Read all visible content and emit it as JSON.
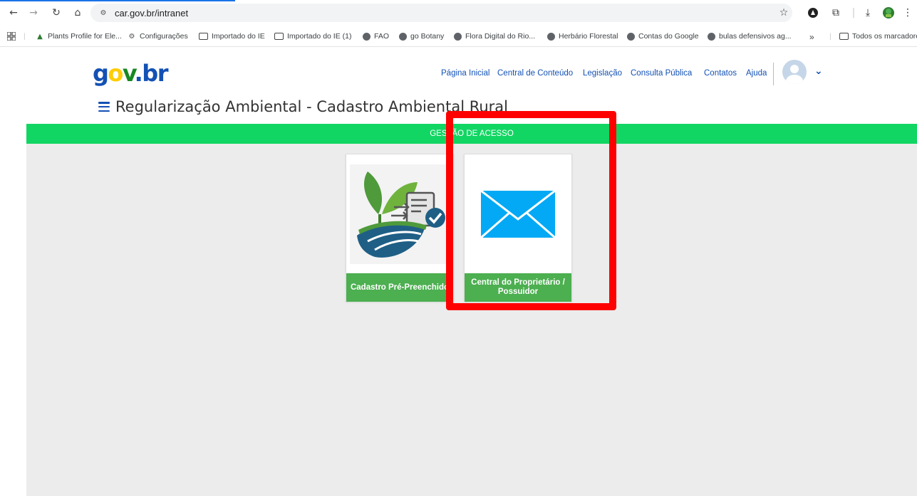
{
  "browser": {
    "url": "car.gov.br/intranet",
    "nav_back": "←",
    "nav_forward": "→",
    "nav_reload": "↻",
    "nav_home": "⌂",
    "star": "☆",
    "ext_puzzle": "⧉",
    "download": "⤓",
    "menu": "⋮",
    "sep": "|",
    "bookmarks": [
      "Plants Profile for Ele...",
      "Configurações",
      "Importado do IE",
      "Importado do IE (1)",
      "FAO",
      "go Botany",
      "Flora Digital do Rio...",
      "Herbário Florestal",
      "Contas do Google",
      "bulas defensivos ag..."
    ],
    "more_bookmarks": "»",
    "all_bookmarks": "Todos os marcadores"
  },
  "header": {
    "logo_g": "g",
    "logo_o": "o",
    "logo_v": "v",
    "logo_dot": ".",
    "logo_br": "br",
    "nav": [
      "Página Inicial",
      "Central de Conteúdo",
      "Legislação",
      "Consulta Pública",
      "Contatos",
      "Ajuda"
    ],
    "chevron": "⌄"
  },
  "page": {
    "title": "Regularização Ambiental - Cadastro Ambiental Rural",
    "section": "GESTÃO DE ACESSO"
  },
  "cards": [
    {
      "label": "Cadastro Pré-Preenchido"
    },
    {
      "label": "Central do Proprietário / Possuidor"
    }
  ],
  "colors": {
    "green_band": "#12d663",
    "card_label": "#4caf50",
    "highlight": "#ff0000",
    "envelope": "#03a9f4",
    "link": "#1351b4"
  }
}
